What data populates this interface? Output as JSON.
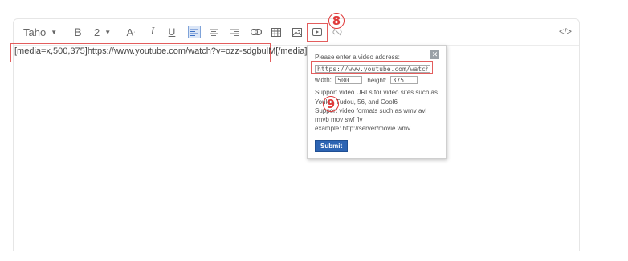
{
  "toolbar": {
    "font_name": "Taho",
    "bold_label": "B",
    "size_label": "2",
    "fontcolor_label": "A",
    "italic_label": "I",
    "underline_label": "U",
    "source_label": "</>"
  },
  "content": {
    "text": "[media=x,500,375]https://www.youtube.com/watch?v=ozz-sdgbulM[/media]"
  },
  "popup": {
    "address_label": "Please enter a video address:",
    "address_value": "https://www.youtube.com/watch?",
    "width_label": "width:",
    "width_value": "500",
    "height_label": "height:",
    "height_value": "375",
    "help_lines": [
      "Support video URLs for video sites such as",
      "Youku, Tudou, 56, and Cool6",
      "Support video formats such as wmv avi",
      "rmvb mov swf flv",
      "example: http://server/movie.wmv"
    ],
    "submit_label": "Submit",
    "close_label": "✕"
  },
  "markers": {
    "m8": "8",
    "m9": "9"
  },
  "colors": {
    "highlight": "#e35d5d",
    "submit_bg": "#2d64b3",
    "marker": "#e03a3a"
  }
}
